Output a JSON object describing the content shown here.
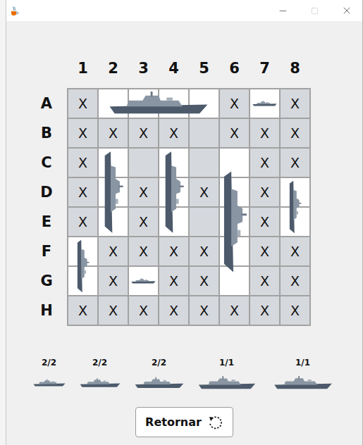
{
  "board": {
    "columns": [
      "1",
      "2",
      "3",
      "4",
      "5",
      "6",
      "7",
      "8"
    ],
    "rows": [
      {
        "label": "A",
        "cells": [
          {
            "kind": "miss",
            "text": "X"
          },
          {
            "kind": "ship",
            "text": ""
          },
          {
            "kind": "ship",
            "text": ""
          },
          {
            "kind": "ship",
            "text": ""
          },
          {
            "kind": "ship",
            "text": ""
          },
          {
            "kind": "miss",
            "text": "X"
          },
          {
            "kind": "ship",
            "text": ""
          },
          {
            "kind": "miss",
            "text": "X"
          }
        ]
      },
      {
        "label": "B",
        "cells": [
          {
            "kind": "miss",
            "text": "X"
          },
          {
            "kind": "miss",
            "text": "X"
          },
          {
            "kind": "miss",
            "text": "X"
          },
          {
            "kind": "miss",
            "text": "X"
          },
          {
            "kind": "empty",
            "text": ""
          },
          {
            "kind": "miss",
            "text": "X"
          },
          {
            "kind": "miss",
            "text": "X"
          },
          {
            "kind": "miss",
            "text": "X"
          }
        ]
      },
      {
        "label": "C",
        "cells": [
          {
            "kind": "miss",
            "text": "X"
          },
          {
            "kind": "ship",
            "text": ""
          },
          {
            "kind": "empty",
            "text": ""
          },
          {
            "kind": "ship",
            "text": ""
          },
          {
            "kind": "empty",
            "text": ""
          },
          {
            "kind": "ship",
            "text": ""
          },
          {
            "kind": "miss",
            "text": "X"
          },
          {
            "kind": "miss",
            "text": "X"
          }
        ]
      },
      {
        "label": "D",
        "cells": [
          {
            "kind": "miss",
            "text": "X"
          },
          {
            "kind": "ship",
            "text": ""
          },
          {
            "kind": "miss",
            "text": "X"
          },
          {
            "kind": "ship",
            "text": ""
          },
          {
            "kind": "miss",
            "text": "X"
          },
          {
            "kind": "ship",
            "text": ""
          },
          {
            "kind": "miss",
            "text": "X"
          },
          {
            "kind": "ship",
            "text": ""
          }
        ]
      },
      {
        "label": "E",
        "cells": [
          {
            "kind": "miss",
            "text": "X"
          },
          {
            "kind": "ship",
            "text": ""
          },
          {
            "kind": "miss",
            "text": "X"
          },
          {
            "kind": "ship",
            "text": ""
          },
          {
            "kind": "empty",
            "text": ""
          },
          {
            "kind": "ship",
            "text": ""
          },
          {
            "kind": "miss",
            "text": "X"
          },
          {
            "kind": "ship",
            "text": ""
          }
        ]
      },
      {
        "label": "F",
        "cells": [
          {
            "kind": "ship",
            "text": ""
          },
          {
            "kind": "miss",
            "text": "X"
          },
          {
            "kind": "miss",
            "text": "X"
          },
          {
            "kind": "miss",
            "text": "X"
          },
          {
            "kind": "miss",
            "text": "X"
          },
          {
            "kind": "ship",
            "text": ""
          },
          {
            "kind": "miss",
            "text": "X"
          },
          {
            "kind": "miss",
            "text": "X"
          }
        ]
      },
      {
        "label": "G",
        "cells": [
          {
            "kind": "ship",
            "text": ""
          },
          {
            "kind": "miss",
            "text": "X"
          },
          {
            "kind": "ship",
            "text": ""
          },
          {
            "kind": "miss",
            "text": "X"
          },
          {
            "kind": "miss",
            "text": "X"
          },
          {
            "kind": "ship",
            "text": ""
          },
          {
            "kind": "miss",
            "text": "X"
          },
          {
            "kind": "miss",
            "text": "X"
          }
        ]
      },
      {
        "label": "H",
        "cells": [
          {
            "kind": "miss",
            "text": "X"
          },
          {
            "kind": "miss",
            "text": "X"
          },
          {
            "kind": "miss",
            "text": "X"
          },
          {
            "kind": "miss",
            "text": "X"
          },
          {
            "kind": "miss",
            "text": "X"
          },
          {
            "kind": "miss",
            "text": "X"
          },
          {
            "kind": "miss",
            "text": "X"
          },
          {
            "kind": "miss",
            "text": "X"
          }
        ]
      }
    ]
  },
  "ships": [
    {
      "row": 0,
      "col": 1,
      "length": 4,
      "vertical": false
    },
    {
      "row": 0,
      "col": 6,
      "length": 1,
      "vertical": false
    },
    {
      "row": 2,
      "col": 1,
      "length": 3,
      "vertical": true
    },
    {
      "row": 2,
      "col": 3,
      "length": 3,
      "vertical": true
    },
    {
      "row": 2,
      "col": 5,
      "length": 5,
      "vertical": true
    },
    {
      "row": 3,
      "col": 7,
      "length": 2,
      "vertical": true
    },
    {
      "row": 5,
      "col": 0,
      "length": 2,
      "vertical": true
    },
    {
      "row": 6,
      "col": 2,
      "length": 1,
      "vertical": false
    }
  ],
  "fleet": [
    {
      "count": "2/2",
      "length": 1
    },
    {
      "count": "2/2",
      "length": 2
    },
    {
      "count": "2/2",
      "length": 3
    },
    {
      "count": "1/1",
      "length": 4
    },
    {
      "count": "1/1",
      "length": 5
    }
  ],
  "button": {
    "label": "Retornar"
  }
}
